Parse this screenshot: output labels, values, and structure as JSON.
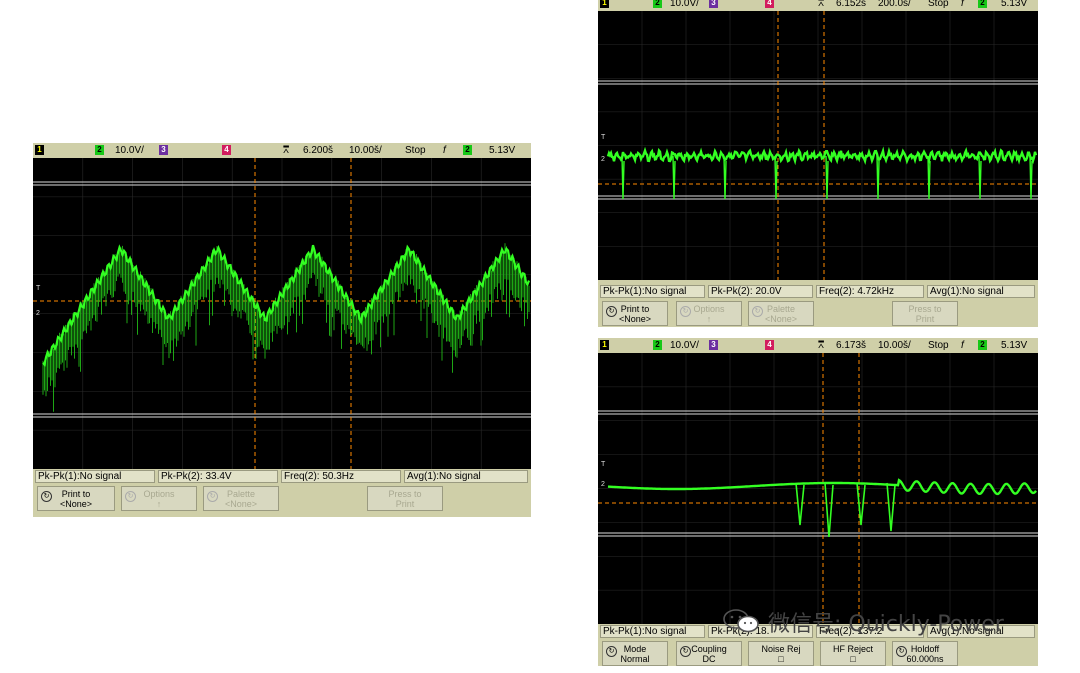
{
  "colors": {
    "trace": "#33ff22",
    "bezel": "#cfcfa8",
    "screen": "#000000",
    "marker": "#ff8a00",
    "ch2": "#18c818",
    "ch3": "#6c2fa0",
    "ch4": "#d21c5e"
  },
  "scopes": [
    {
      "id": "left",
      "topbar": {
        "ch1": "1",
        "ch2": "2",
        "ch2_scale": "10.0V/",
        "ch3": "3",
        "ch4": "4",
        "time_pos": "6.200š",
        "time_scale": "10.00š/",
        "run_state": "Stop",
        "trigger_icon": "f",
        "trigger_ch": "2",
        "trigger_level": "5.13V"
      },
      "measurements": [
        "Pk-Pk(1):No signal",
        "Pk-Pk(2): 33.4V",
        "Freq(2): 50.3Hz",
        "Avg(1):No signal"
      ],
      "softkeys": [
        {
          "label": "Print to",
          "value": "<None>",
          "enabled": true
        },
        {
          "label": "Options",
          "value": "↑",
          "enabled": false
        },
        {
          "label": "Palette",
          "value": "<None>",
          "enabled": false
        },
        {
          "label": "",
          "value": "",
          "enabled": false
        },
        {
          "label": "Press to",
          "value": "Print",
          "enabled": false
        }
      ]
    },
    {
      "id": "top-right",
      "topbar": {
        "ch1": "1",
        "ch2": "2",
        "ch2_scale": "10.0V/",
        "ch3": "3",
        "ch4": "4",
        "time_pos": "6.152š",
        "time_scale": "200.0š/",
        "run_state": "Stop",
        "trigger_icon": "f",
        "trigger_ch": "2",
        "trigger_level": "5.13V"
      },
      "measurements": [
        "Pk-Pk(1):No signal",
        "Pk-Pk(2): 20.0V",
        "Freq(2): 4.72kHz",
        "Avg(1):No signal"
      ],
      "softkeys": [
        {
          "label": "Print to",
          "value": "<None>",
          "enabled": true
        },
        {
          "label": "Options",
          "value": "↑",
          "enabled": false
        },
        {
          "label": "Palette",
          "value": "<None>",
          "enabled": false
        },
        {
          "label": "",
          "value": "",
          "enabled": false
        },
        {
          "label": "Press to",
          "value": "Print",
          "enabled": false
        }
      ]
    },
    {
      "id": "bottom-right",
      "topbar": {
        "ch1": "1",
        "ch2": "2",
        "ch2_scale": "10.0V/",
        "ch3": "3",
        "ch4": "4",
        "time_pos": "6.173š",
        "time_scale": "10.00š/",
        "run_state": "Stop",
        "trigger_icon": "f",
        "trigger_ch": "2",
        "trigger_level": "5.13V"
      },
      "measurements": [
        "Pk-Pk(1):No signal",
        "Pk-Pk(2): 18.",
        "Freq(2): 137.2",
        "Avg(1):No signal"
      ],
      "softkeys": [
        {
          "label": "Mode",
          "value": "Normal",
          "enabled": true
        },
        {
          "label": "Coupling",
          "value": "DC",
          "enabled": true
        },
        {
          "label": "Noise Rej",
          "value": "□",
          "enabled": true
        },
        {
          "label": "HF Reject",
          "value": "□",
          "enabled": true
        },
        {
          "label": "Holdoff",
          "value": "60.000ns",
          "enabled": true
        }
      ]
    }
  ],
  "watermark": {
    "text": "微信号: Quickly-Power",
    "icon": "wechat-icon"
  }
}
